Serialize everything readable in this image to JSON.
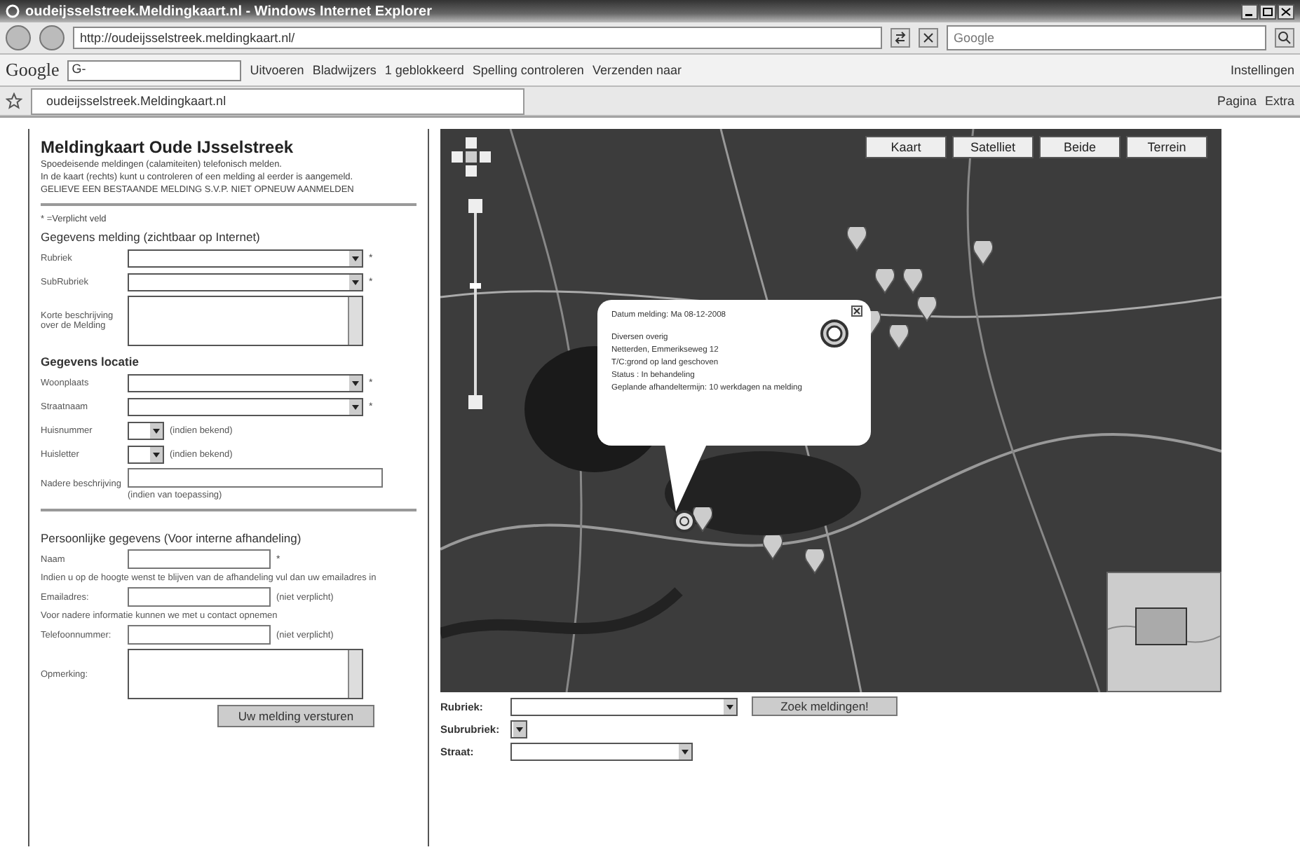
{
  "window": {
    "title": "oudeijsselstreek.Meldingkaart.nl - Windows Internet Explorer"
  },
  "address_bar": {
    "url": "http://oudeijsselstreek.meldingkaart.nl/",
    "search_placeholder": "Google"
  },
  "google_toolbar": {
    "logo": "Google",
    "field": "G-",
    "items": [
      "Uitvoeren",
      "Bladwijzers",
      "1 geblokkeerd",
      "Spelling controleren",
      "Verzenden naar"
    ],
    "settings": "Instellingen"
  },
  "tab": {
    "label": "oudeijsselstreek.Meldingkaart.nl"
  },
  "command_bar": [
    "Pagina",
    "Extra"
  ],
  "form": {
    "title": "Meldingkaart Oude IJsselstreek",
    "subtitle": "Spoedeisende meldingen (calamiteiten) telefonisch melden.",
    "intro": "In de kaart (rechts) kunt u controleren of een melding al eerder is aangemeld.",
    "warning": "GELIEVE EEN BESTAANDE MELDING S.V.P. NIET OPNEUW AANMELDEN",
    "required_note": "* =Verplicht veld",
    "sections": [
      {
        "heading": "Gegevens melding (zichtbaar op Internet)",
        "fields": [
          {
            "kind": "select",
            "label": "Rubriek",
            "mark": "*"
          },
          {
            "kind": "select",
            "label": "SubRubriek",
            "mark": "*"
          },
          {
            "kind": "textarea",
            "label": "Korte beschrijving over de Melding"
          }
        ]
      },
      {
        "heading": "Gegevens locatie",
        "fields": [
          {
            "kind": "select",
            "label": "Woonplaats",
            "mark": "*"
          },
          {
            "kind": "select",
            "label": "Straatnaam",
            "mark": "*"
          },
          {
            "kind": "smallselect",
            "label": "Huisnummer",
            "note": "(indien bekend)"
          },
          {
            "kind": "smallselect",
            "label": "Huisletter",
            "note": "(indien bekend)"
          },
          {
            "kind": "wideinput",
            "label": "Nadere beschrijving",
            "note": "(indien van toepassing)"
          }
        ]
      }
    ],
    "personal": {
      "heading": "Persoonlijke gegevens (Voor interne afhandeling)",
      "items": [
        {
          "kind": "input",
          "label": "Naam",
          "mark": "*"
        },
        {
          "kind": "text",
          "text": "Indien u op de hoogte wenst te blijven van de afhandeling vul dan uw emailadres in"
        },
        {
          "kind": "input",
          "label": "Emailadres:",
          "note": "(niet verplicht)"
        },
        {
          "kind": "text",
          "text": "Voor nadere informatie kunnen we met u contact opnemen"
        },
        {
          "kind": "input",
          "label": "Telefoonnummer:",
          "note": "(niet verplicht)"
        },
        {
          "kind": "textarea",
          "label": "Opmerking:"
        }
      ]
    },
    "submit": "Uw melding versturen"
  },
  "map": {
    "types": [
      "Kaart",
      "Satelliet",
      "Beide",
      "Terrein"
    ],
    "popup": {
      "date": "Datum melding: Ma 08-12-2008",
      "lines": [
        "Diversen overig",
        "Netterden, Emmerikseweg 12",
        "T/C:grond op land geschoven",
        "Status : In behandeling",
        "Geplande afhandeltermijn: 10 werkdagen na melding"
      ]
    }
  },
  "filter": {
    "rows": [
      {
        "label": "Rubriek:",
        "kind": "select"
      },
      {
        "label": "Subrubriek:",
        "kind": "tiny"
      },
      {
        "label": "Straat:",
        "kind": "medium"
      }
    ],
    "button": "Zoek meldingen!"
  }
}
